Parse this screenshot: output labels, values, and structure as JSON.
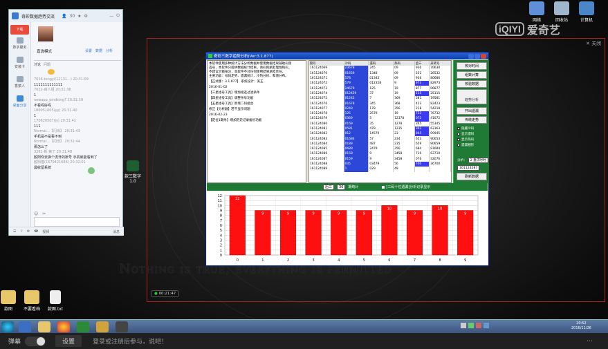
{
  "desktop": {
    "icons_top_right": [
      "网络",
      "回收站",
      "计算机"
    ],
    "icons_bottom": [
      "款图",
      "不要看档",
      "款图.txt"
    ],
    "mid_icon": "款三数字\n1.0",
    "iqiyi_logo": "爱奇艺",
    "overlay_text": "Nothing is true, everything is permitted",
    "timestamp_badge": "00:21:47",
    "close_label": "关闭",
    "clock_time": "20:52",
    "clock_date": "2016/11/26"
  },
  "chat": {
    "title": "奇彩数据趋势交流",
    "count": "30",
    "nav": [
      "下载",
      "数字服务",
      "安装卡",
      "香菜人",
      "桌面分享"
    ],
    "group_label": "直选模式",
    "tabs": [
      "讨论",
      "问题"
    ],
    "header_links": [
      "设置",
      "数据",
      "分析"
    ],
    "messages": [
      {
        "name": "7016-tengyi(12131...) 20:31:09",
        "text": "1111111111111"
      },
      {
        "name": "7022-四人组 20:31:38",
        "text": "1"
      },
      {
        "name": "newapp_pindking7 20:31:39",
        "text": "不看吗好吗"
      },
      {
        "name": "186051005(yy) 20:31:40",
        "text": "1"
      },
      {
        "name": "170620507(jy) 20:31:41",
        "text": "111"
      },
      {
        "name": "Normal...【闪烁】 20:31:43",
        "text": "手机是不是看不到"
      },
      {
        "name": "Normal...【闪烁】 20:31:44",
        "text": "那怎么了"
      },
      {
        "name": "3261-新 第了 20:31:48",
        "text": "胶阳你去换个虎牙的账号 手机就能看到了"
      },
      {
        "name": "胶阳猫(1679421686) 20:32:01",
        "text": "最收留系统"
      }
    ],
    "input_placeholder": "",
    "bottom_icons": [
      "表情",
      "图片",
      "视频",
      "消息"
    ],
    "send_label": "消息"
  },
  "tool": {
    "title": "奇彩三数字趋势分析(Ver:3.1.877)",
    "notes": [
      "本软件使用多种统计方法分析数据并使用数据结果辅助彩民",
      "选号，本软件只提供数据统计结果，请彩民朋友理性购彩。",
      "不建议大额投注，本软件不对任何使用结果承担责任。",
      "主要功能：号码走势、遗漏统计、冷热分析、和值分布。",
      "【正式版：3.1.877】 系统设计：美王",
      "2016-01-02",
      "【三星组号工具】增加组选过滤条件",
      "【四星组号工具】调整杀号功能",
      "【五星组号工具】新增二码组合",
      "修正【分析器】若干显示问题",
      "2016-02-23",
      "【定位1期杀】增加历史记录备份功能"
    ],
    "grid_headers": [
      "期号",
      "冷码",
      "遗码",
      "热码",
      "后三",
      "开奖号"
    ],
    "grid_rows": [
      [
        "161124069",
        "23678",
        "245",
        "09",
        "930",
        "70630"
      ],
      [
        "161124070",
        "01659",
        "1348",
        "09",
        "532",
        "26532"
      ],
      [
        "161124071",
        "578",
        "01345",
        "09",
        "936",
        "80686"
      ],
      [
        "161124072",
        "579",
        "012358",
        "9",
        "973",
        "82973"
      ],
      [
        "161124073",
        "24679",
        "125",
        "19",
        "877",
        "06877"
      ],
      [
        "161124074",
        "012459",
        "37",
        "19",
        "115",
        "25115"
      ],
      [
        "161124075",
        "01245",
        "7",
        "369",
        "581",
        "19581"
      ],
      [
        "161124076",
        "01678",
        "345",
        "368",
        "423",
        "82423"
      ],
      [
        "161124077",
        "0249",
        "178",
        "356",
        "218",
        "54218"
      ],
      [
        "161124078",
        "125",
        "2579",
        "19",
        "732",
        "76732"
      ],
      [
        "161124079",
        "0369",
        "5",
        "12378",
        "072",
        "41072"
      ],
      [
        "161124080",
        "0169",
        "35",
        "1278",
        "345",
        "55345"
      ],
      [
        "161124081",
        "0581",
        "478",
        "1235",
        "363",
        "62363"
      ],
      [
        "161124082",
        "012",
        "14579",
        "23",
        "945",
        "09945"
      ],
      [
        "161124083",
        "01684",
        "57",
        "234",
        "653",
        "90653"
      ],
      [
        "161124084",
        "0189",
        "487",
        "235",
        "659",
        "90659"
      ],
      [
        "161124085",
        "0689",
        "2479",
        "356",
        "684",
        "91684"
      ],
      [
        "161124086",
        "0158",
        "9",
        "3458",
        "710",
        "63710"
      ],
      [
        "161124087",
        "0159",
        "9",
        "3458",
        "076",
        "32076"
      ],
      [
        "161124088",
        "035",
        "03479",
        "56",
        "700",
        "36700"
      ],
      [
        "161124089",
        "1",
        "029",
        "49",
        "",
        ""
      ]
    ],
    "buttons": [
      "校对时间",
      "组数计算",
      "校验数据",
      "趋势分析",
      "开出遗漏",
      "传统走势",
      "刷新数据"
    ],
    "checks": [
      "隐藏冷码",
      "显示遗码",
      "显示热码",
      "遗漏相形"
    ],
    "combo_label": "分析：",
    "combo_value": "2 重庆时时",
    "period_value": "161124087",
    "ctrl_sel1": "后三",
    "ctrl_sel2": "36",
    "ctrl_text": "期统计",
    "ctrl_check": "[三码十位遗漏]分析记录显示"
  },
  "chart_data": {
    "type": "bar",
    "categories": [
      "0",
      "1",
      "2",
      "3",
      "4",
      "5",
      "6",
      "7",
      "8",
      "9"
    ],
    "values": [
      12,
      9,
      9,
      9,
      9,
      9,
      10,
      9,
      10,
      9
    ],
    "ylim": [
      0,
      12
    ],
    "yticks": [
      0,
      1,
      2,
      3,
      4,
      5,
      6,
      7,
      8,
      9,
      10,
      11,
      12
    ],
    "grid": true,
    "bar_color": "#ff1010",
    "title": "",
    "xlabel": "",
    "ylabel": ""
  },
  "player": {
    "danmu_label": "弹幕",
    "settings_label": "设置",
    "input_hint": "登录或注册后参与，说吧！"
  }
}
